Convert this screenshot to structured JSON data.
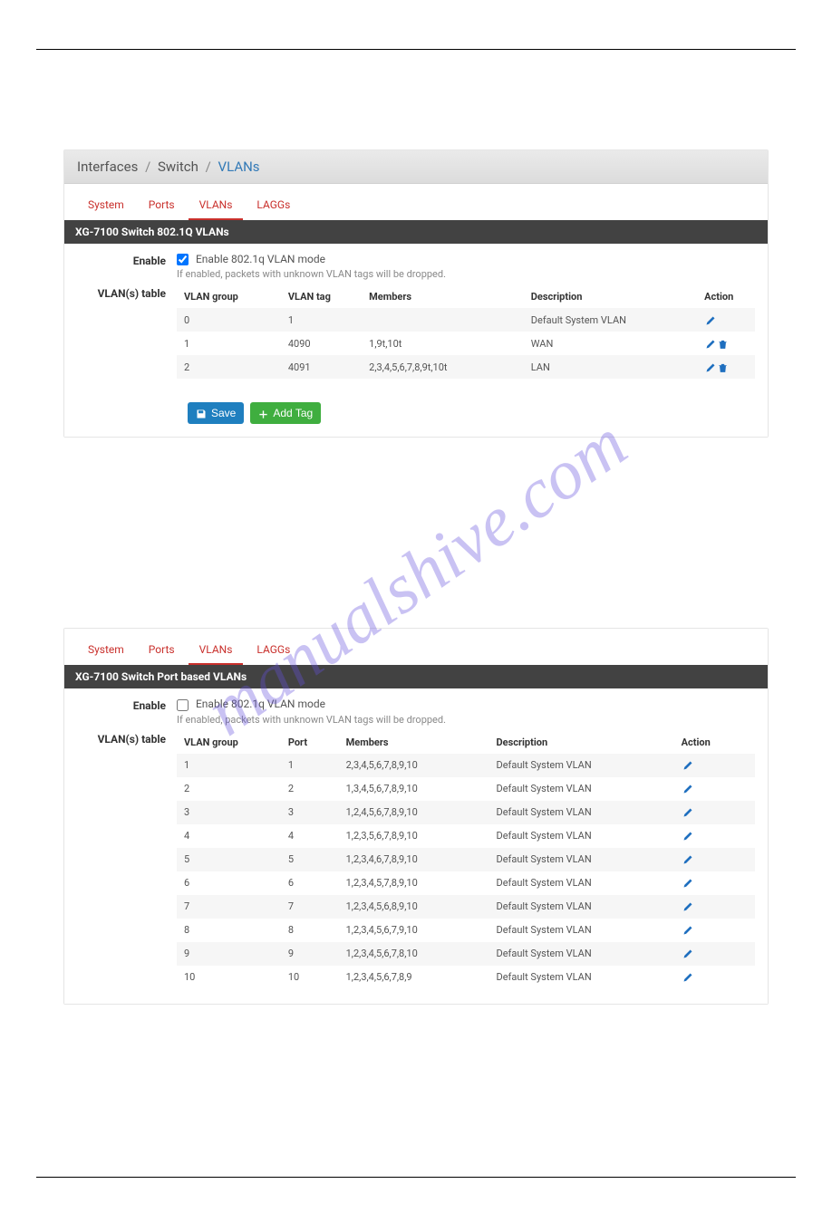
{
  "watermark_text": "manualshive.com",
  "breadcrumb": {
    "root": "Interfaces",
    "mid": "Switch",
    "leaf": "VLANs"
  },
  "tabs": {
    "system": "System",
    "ports": "Ports",
    "vlans": "VLANs",
    "laggs": "LAGGs"
  },
  "panel1": {
    "heading": "XG-7100 Switch 802.1Q VLANs",
    "enable_label": "Enable",
    "enable_checked": true,
    "enable_text": "Enable 802.1q VLAN mode",
    "enable_help": "If enabled, packets with unknown VLAN tags will be dropped.",
    "table_label": "VLAN(s) table",
    "columns": {
      "group": "VLAN group",
      "tag": "VLAN tag",
      "members": "Members",
      "description": "Description",
      "action": "Action"
    },
    "rows": [
      {
        "group": "0",
        "tag": "1",
        "members": "",
        "description": "Default System VLAN",
        "deletable": false
      },
      {
        "group": "1",
        "tag": "4090",
        "members": "1,9t,10t",
        "description": "WAN",
        "deletable": true
      },
      {
        "group": "2",
        "tag": "4091",
        "members": "2,3,4,5,6,7,8,9t,10t",
        "description": "LAN",
        "deletable": true
      }
    ],
    "save_label": "Save",
    "addtag_label": "Add Tag"
  },
  "panel2": {
    "heading": "XG-7100 Switch Port based VLANs",
    "enable_label": "Enable",
    "enable_checked": false,
    "enable_text": "Enable 802.1q VLAN mode",
    "enable_help": "If enabled, packets with unknown VLAN tags will be dropped.",
    "table_label": "VLAN(s) table",
    "columns": {
      "group": "VLAN group",
      "port": "Port",
      "members": "Members",
      "description": "Description",
      "action": "Action"
    },
    "rows": [
      {
        "group": "1",
        "port": "1",
        "members": "2,3,4,5,6,7,8,9,10",
        "description": "Default System VLAN"
      },
      {
        "group": "2",
        "port": "2",
        "members": "1,3,4,5,6,7,8,9,10",
        "description": "Default System VLAN"
      },
      {
        "group": "3",
        "port": "3",
        "members": "1,2,4,5,6,7,8,9,10",
        "description": "Default System VLAN"
      },
      {
        "group": "4",
        "port": "4",
        "members": "1,2,3,5,6,7,8,9,10",
        "description": "Default System VLAN"
      },
      {
        "group": "5",
        "port": "5",
        "members": "1,2,3,4,6,7,8,9,10",
        "description": "Default System VLAN"
      },
      {
        "group": "6",
        "port": "6",
        "members": "1,2,3,4,5,7,8,9,10",
        "description": "Default System VLAN"
      },
      {
        "group": "7",
        "port": "7",
        "members": "1,2,3,4,5,6,8,9,10",
        "description": "Default System VLAN"
      },
      {
        "group": "8",
        "port": "8",
        "members": "1,2,3,4,5,6,7,9,10",
        "description": "Default System VLAN"
      },
      {
        "group": "9",
        "port": "9",
        "members": "1,2,3,4,5,6,7,8,10",
        "description": "Default System VLAN"
      },
      {
        "group": "10",
        "port": "10",
        "members": "1,2,3,4,5,6,7,8,9",
        "description": "Default System VLAN"
      }
    ]
  }
}
